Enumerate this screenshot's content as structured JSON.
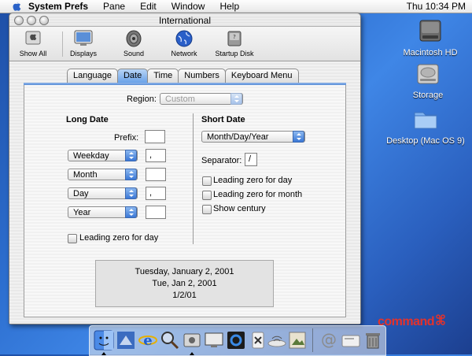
{
  "menubar": {
    "app": "System Prefs",
    "items": [
      "Pane",
      "Edit",
      "Window",
      "Help"
    ],
    "clock": "Thu 10:34 PM"
  },
  "desktop": {
    "icons": [
      {
        "label": "Macintosh HD",
        "icon": "hard-drive-icon"
      },
      {
        "label": "Storage",
        "icon": "drive-icon"
      },
      {
        "label": "Desktop (Mac OS 9)",
        "icon": "folder-icon"
      }
    ]
  },
  "window": {
    "title": "International",
    "toolbar": [
      {
        "label": "Show All",
        "icon": "apple-icon"
      },
      {
        "label": "Displays",
        "icon": "display-icon"
      },
      {
        "label": "Sound",
        "icon": "speaker-icon"
      },
      {
        "label": "Network",
        "icon": "globe-icon"
      },
      {
        "label": "Startup Disk",
        "icon": "disk-icon"
      }
    ],
    "tabs": [
      {
        "label": "Language",
        "selected": false
      },
      {
        "label": "Date",
        "selected": true
      },
      {
        "label": "Time",
        "selected": false
      },
      {
        "label": "Numbers",
        "selected": false
      },
      {
        "label": "Keyboard Menu",
        "selected": false
      }
    ]
  },
  "date_pane": {
    "region_label": "Region:",
    "region_value": "Custom",
    "long_date": {
      "heading": "Long Date",
      "prefix_label": "Prefix:",
      "prefix_value": "",
      "rows": [
        {
          "popup": "Weekday",
          "separator": ","
        },
        {
          "popup": "Month",
          "separator": ""
        },
        {
          "popup": "Day",
          "separator": ","
        },
        {
          "popup": "Year",
          "separator": ""
        }
      ],
      "leading_zero_day": "Leading zero for day"
    },
    "short_date": {
      "heading": "Short Date",
      "format": "Month/Day/Year",
      "separator_label": "Separator:",
      "separator_value": "/",
      "checks": [
        "Leading zero for day",
        "Leading zero for month",
        "Show century"
      ]
    },
    "samples": [
      "Tuesday, January 2, 2001",
      "Tue, Jan 2, 2001",
      "1/2/01"
    ]
  },
  "dock": {
    "items": [
      "finder-icon",
      "mail-icon",
      "internet-explorer-icon",
      "sherlock-icon",
      "system-preferences-icon",
      "quicktime-icon",
      "ical-icon",
      "x-icon",
      "airport-icon",
      "preview-icon",
      "address-icon",
      "document-icon",
      "trash-icon"
    ]
  },
  "watermark": "command"
}
